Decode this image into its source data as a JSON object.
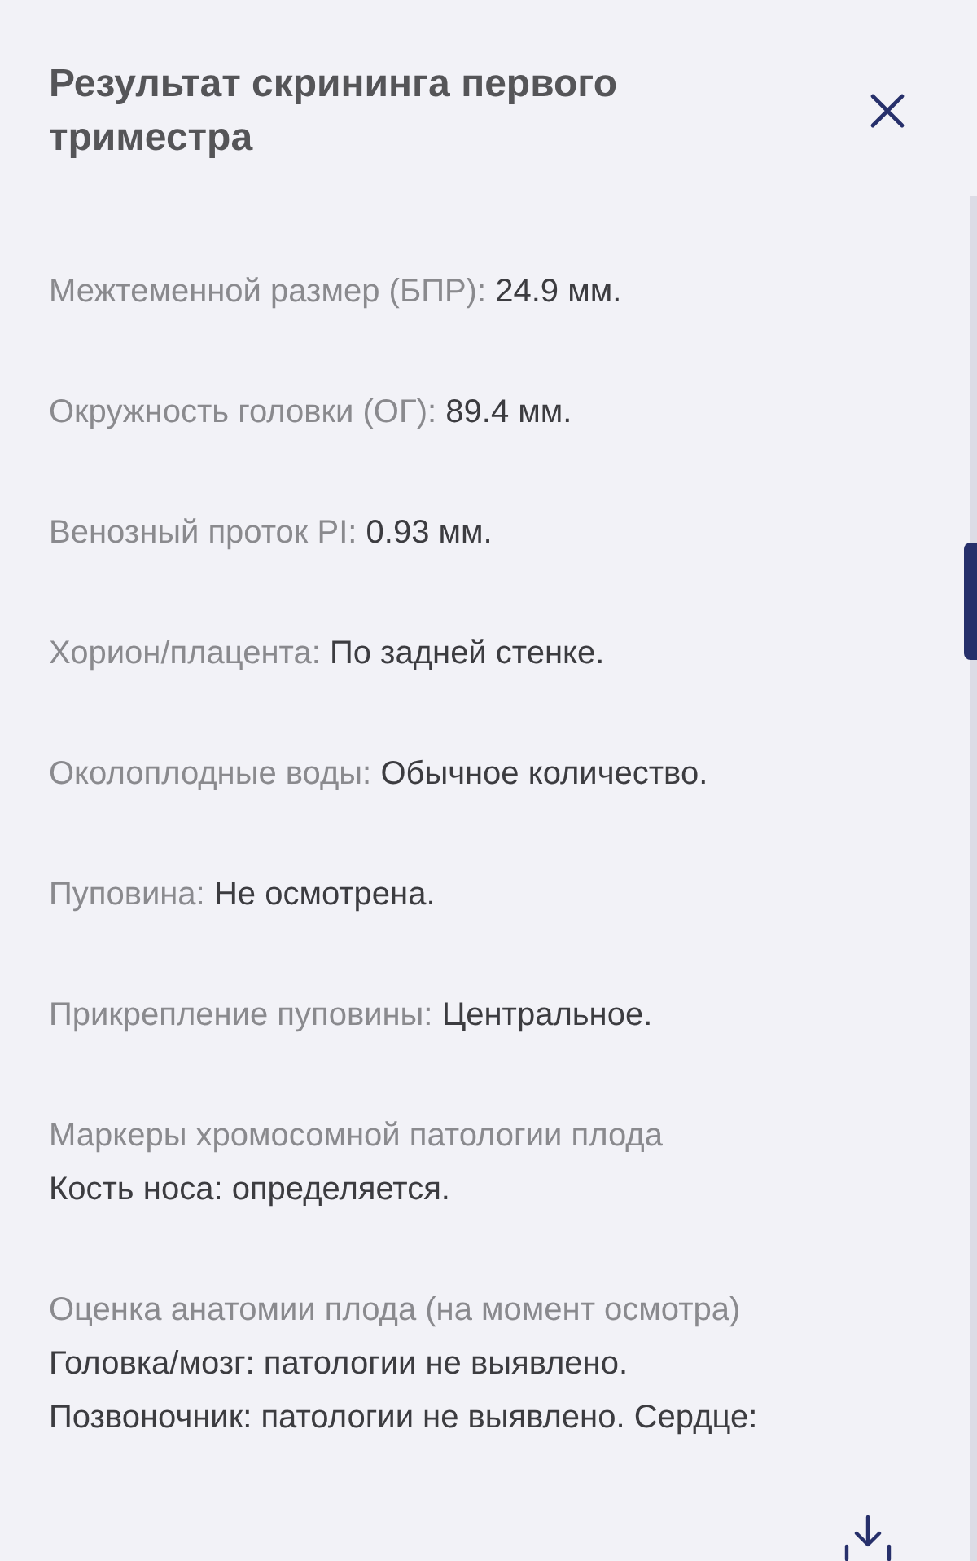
{
  "dialog": {
    "title": "Результат скрининга первого триместра"
  },
  "fields": [
    {
      "kind": "inline",
      "label": "Межтеменной размер (БПР):",
      "value": "24.9 мм."
    },
    {
      "kind": "inline",
      "label": "Окружность головки (ОГ):",
      "value": "89.4 мм."
    },
    {
      "kind": "inline",
      "label": "Венозный проток PI:",
      "value": "0.93 мм."
    },
    {
      "kind": "inline",
      "label": "Хорион/плацента:",
      "value": "По задней стенке."
    },
    {
      "kind": "inline",
      "label": "Околоплодные воды:",
      "value": "Обычное количество."
    },
    {
      "kind": "inline",
      "label": "Пуповина:",
      "value": "Не осмотрена."
    },
    {
      "kind": "inline",
      "label": "Прикрепление пуповины:",
      "value": "Центральное."
    },
    {
      "kind": "stacked",
      "label": "Маркеры хромосомной патологии плода",
      "lines": [
        "Кость носа: определяется."
      ]
    },
    {
      "kind": "stacked",
      "label": "Оценка анатомии плода (на момент осмотра)",
      "lines": [
        "Головка/мозг: патологии не выявлено.",
        "Позвоночник: патологии не выявлено. Сердце:"
      ]
    }
  ]
}
